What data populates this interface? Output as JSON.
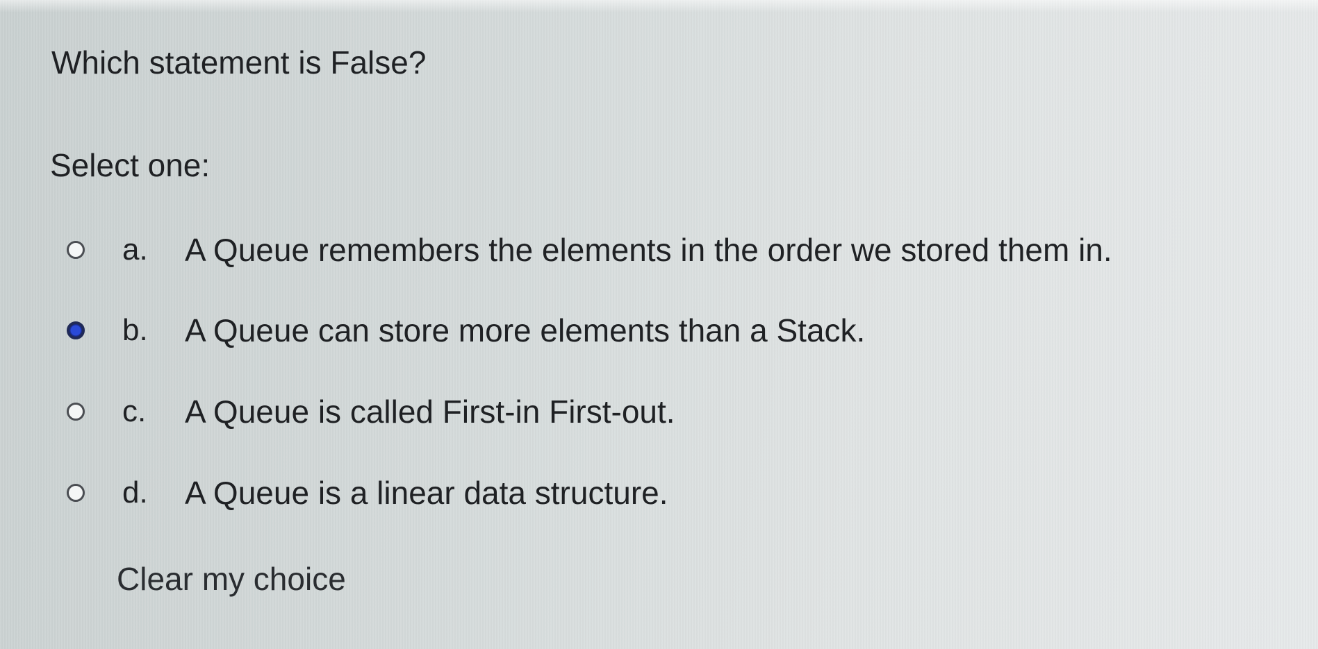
{
  "question": {
    "text": "Which statement is False?",
    "prompt": "Select one:",
    "answers": [
      {
        "letter": "a.",
        "text": "A Queue remembers the elements in the order we stored them in.",
        "selected": false
      },
      {
        "letter": "b.",
        "text": "A Queue can store more elements than a Stack.",
        "selected": true
      },
      {
        "letter": "c.",
        "text": "A Queue is called First-in First-out.",
        "selected": false
      },
      {
        "letter": "d.",
        "text": "A Queue is a linear data structure.",
        "selected": false
      }
    ],
    "clear_label": "Clear my choice"
  },
  "colors": {
    "radio_selected": "#2a4ad8",
    "text": "#1f2124"
  }
}
